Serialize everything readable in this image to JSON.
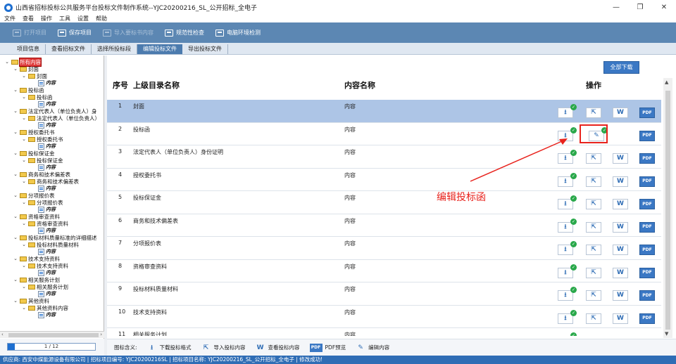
{
  "window": {
    "title": "山西省招标投标公共服务平台投标文件制作系统--YJC20200216_SL_公开招标_全电子",
    "minimize": "—",
    "maximize": "❐",
    "close": "✕"
  },
  "menu": [
    "文件",
    "查看",
    "操作",
    "工具",
    "设置",
    "帮助"
  ],
  "toolbar": [
    {
      "label": "打开项目",
      "enabled": false
    },
    {
      "label": "保存项目",
      "enabled": true
    },
    {
      "label": "导入要标书内容",
      "enabled": false
    },
    {
      "label": "规范性检查",
      "enabled": true
    },
    {
      "label": "电脑环境检测",
      "enabled": true
    }
  ],
  "tabs": [
    "项目信息",
    "查看招标文件",
    "选择所投标段",
    "编辑投标文件",
    "导出投标文件"
  ],
  "active_tab": "编辑投标文件",
  "tree": {
    "root": "所有内容",
    "leaf": "内容",
    "groups": [
      {
        "name": "封面",
        "sub": "封面"
      },
      {
        "name": "投标函",
        "sub": "投标函"
      },
      {
        "name": "法定代表人（单位负责人）身",
        "sub": "法定代表人（单位负责人）"
      },
      {
        "name": "授权委托书",
        "sub": "授权委托书"
      },
      {
        "name": "投标保证金",
        "sub": "投标保证金"
      },
      {
        "name": "商务和技术偏差表",
        "sub": "商务和技术偏差表"
      },
      {
        "name": "分项报价表",
        "sub": "分项报价表"
      },
      {
        "name": "资格审查资料",
        "sub": "资格审查资料"
      },
      {
        "name": "投标材料质量标准的详细描述",
        "sub": "投标材料质量材料"
      },
      {
        "name": "技术支持资料",
        "sub": "技术支持资料"
      },
      {
        "name": "相关服务计划",
        "sub": "相关服务计划"
      },
      {
        "name": "其他资料",
        "sub": "其他资料内容"
      }
    ]
  },
  "pager": {
    "text": "1 / 12",
    "fraction": 0.083
  },
  "main": {
    "download_all": "全部下载",
    "headers": {
      "no": "序号",
      "parent": "上级目录名称",
      "content": "内容名称",
      "ops": "操作"
    },
    "rows": [
      {
        "no": "1",
        "parent": "封面",
        "content": "内容"
      },
      {
        "no": "2",
        "parent": "投标函",
        "content": "内容"
      },
      {
        "no": "3",
        "parent": "法定代表人（单位负责人）身份证明",
        "content": "内容"
      },
      {
        "no": "4",
        "parent": "授权委托书",
        "content": "内容"
      },
      {
        "no": "5",
        "parent": "投标保证金",
        "content": "内容"
      },
      {
        "no": "6",
        "parent": "商务和技术偏差表",
        "content": "内容"
      },
      {
        "no": "7",
        "parent": "分项报价表",
        "content": "内容"
      },
      {
        "no": "8",
        "parent": "资格审查资料",
        "content": "内容"
      },
      {
        "no": "9",
        "parent": "投标材料质量材料",
        "content": "内容"
      },
      {
        "no": "10",
        "parent": "技术支持资料",
        "content": "内容"
      },
      {
        "no": "11",
        "parent": "相关服务计划",
        "content": "内容"
      }
    ],
    "op_icons": {
      "download": "⭳",
      "import": "⇱",
      "view": "W",
      "pdf": "PDF"
    }
  },
  "annotation": "编辑投标函",
  "legend": {
    "title": "图标含义:",
    "items": [
      {
        "icon": "⭳",
        "label": "下载投标格式"
      },
      {
        "icon": "⇱",
        "label": "导入投标内容"
      },
      {
        "icon": "W",
        "label": "查看投标内容"
      },
      {
        "icon": "PDF",
        "label": "PDF预览"
      },
      {
        "icon": "✎",
        "label": "编辑内容"
      }
    ]
  },
  "status": "供应商: 西安中煤能源设备有限公司 | 招标项目编号: YJC20200216SL | 招标项目名称: YJC20200216_SL_公开招标_全电子 | 修改成功!",
  "colors": {
    "accent": "#3b78c4",
    "toolbar": "#5c87b3",
    "annotation": "#e8231d",
    "check": "#29a84a",
    "selected_row": "#adc5e6"
  }
}
